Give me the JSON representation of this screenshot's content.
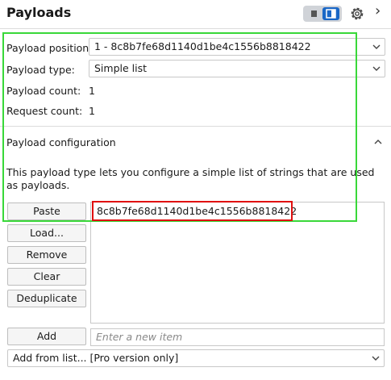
{
  "header": {
    "title": "Payloads",
    "close_symbol": "›"
  },
  "fields": {
    "position_label": "Payload position:",
    "position_value": "1 - 8c8b7fe68d1140d1be4c1556b8818422",
    "type_label": "Payload type:",
    "type_value": "Simple list",
    "count_label": "Payload count:",
    "count_value": "1",
    "request_label": "Request count:",
    "request_value": "1"
  },
  "config": {
    "title": "Payload configuration",
    "collapse_symbol": "⌃",
    "description": "This payload type lets you configure a simple list of strings that are used as payloads."
  },
  "buttons": {
    "paste": "Paste",
    "load": "Load...",
    "remove": "Remove",
    "clear": "Clear",
    "deduplicate": "Deduplicate",
    "add": "Add"
  },
  "list": {
    "items": [
      "8c8b7fe68d1140d1be4c1556b8818422"
    ]
  },
  "add_input": {
    "placeholder": "Enter a new item"
  },
  "add_from_list": {
    "value": "Add from list... [Pro version only]"
  },
  "colors": {
    "toggle_accent": "#1a67c6",
    "highlight_green": "#39d839",
    "highlight_red": "#e01010"
  }
}
